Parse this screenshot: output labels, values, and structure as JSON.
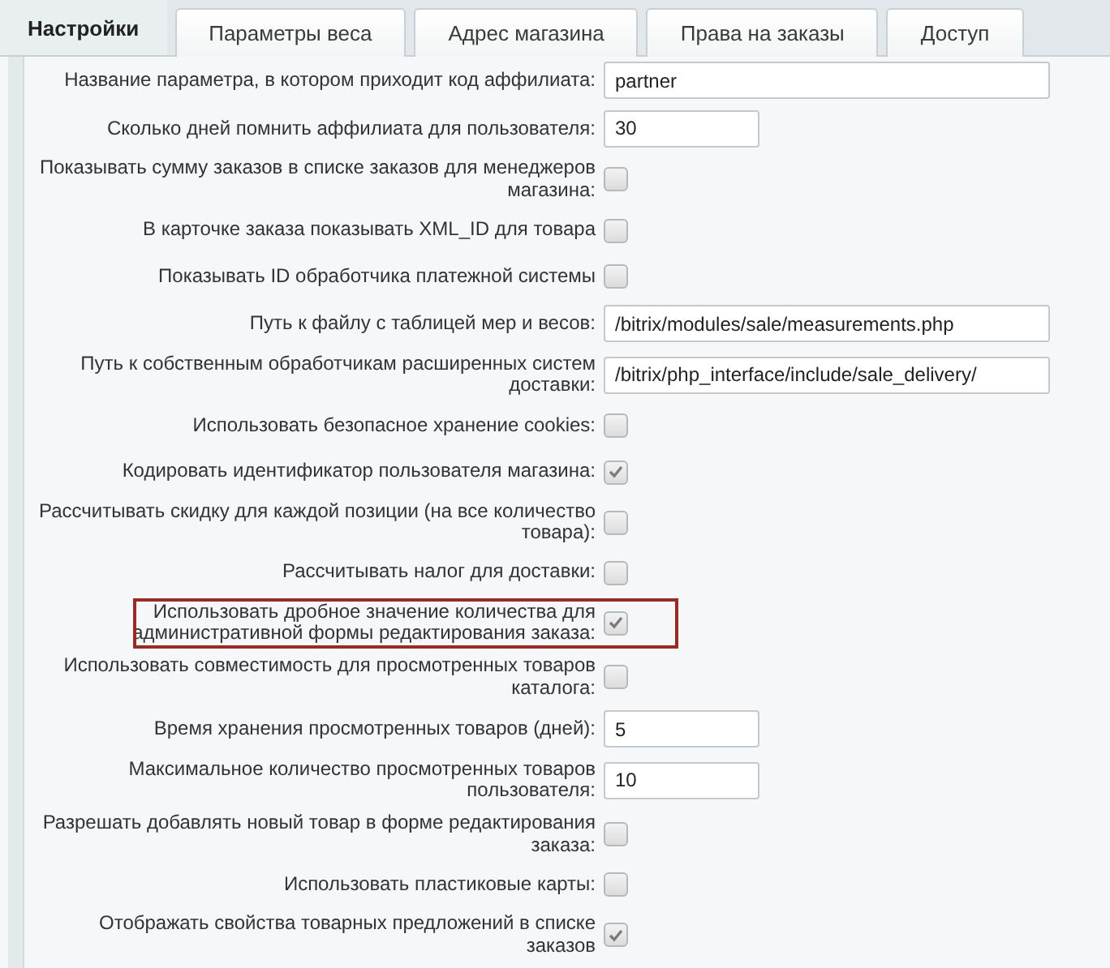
{
  "tabs": [
    {
      "label": "Настройки",
      "selected": true
    },
    {
      "label": "Параметры веса",
      "selected": false
    },
    {
      "label": "Адрес магазина",
      "selected": false
    },
    {
      "label": "Права на заказы",
      "selected": false
    },
    {
      "label": "Доступ",
      "selected": false
    }
  ],
  "settings": [
    {
      "kind": "text",
      "label": "Название параметра, в котором приходит код аффилиата:",
      "value": "partner",
      "wide": true
    },
    {
      "kind": "text",
      "label": "Сколько дней помнить аффилиата для пользователя:",
      "value": "30",
      "wide": false
    },
    {
      "kind": "checkbox",
      "label": "Показывать сумму заказов в списке заказов для менеджеров магазина:",
      "checked": false,
      "highlighted": false
    },
    {
      "kind": "checkbox",
      "label": "В карточке заказа показывать XML_ID для товара",
      "checked": false,
      "highlighted": false
    },
    {
      "kind": "checkbox",
      "label": "Показывать ID обработчика платежной системы",
      "checked": false,
      "highlighted": false
    },
    {
      "kind": "text",
      "label": "Путь к файлу с таблицей мер и весов:",
      "value": "/bitrix/modules/sale/measurements.php",
      "wide": true
    },
    {
      "kind": "text",
      "label": "Путь к собственным обработчикам расширенных систем доставки:",
      "value": "/bitrix/php_interface/include/sale_delivery/",
      "wide": true
    },
    {
      "kind": "checkbox",
      "label": "Использовать безопасное хранение cookies:",
      "checked": false,
      "highlighted": false
    },
    {
      "kind": "checkbox",
      "label": "Кодировать идентификатор пользователя магазина:",
      "checked": true,
      "highlighted": false
    },
    {
      "kind": "checkbox",
      "label": "Рассчитывать скидку для каждой позиции (на все количество товара):",
      "checked": false,
      "highlighted": false
    },
    {
      "kind": "checkbox",
      "label": "Рассчитывать налог для доставки:",
      "checked": false,
      "highlighted": false
    },
    {
      "kind": "checkbox",
      "label": "Использовать дробное значение количества для административной формы редактирования заказа:",
      "checked": true,
      "highlighted": true
    },
    {
      "kind": "checkbox",
      "label": "Использовать совместимость для просмотренных товаров каталога:",
      "checked": false,
      "highlighted": false
    },
    {
      "kind": "text",
      "label": "Время хранения просмотренных товаров (дней):",
      "value": "5",
      "wide": false
    },
    {
      "kind": "text",
      "label": "Максимальное количество просмотренных товаров пользователя:",
      "value": "10",
      "wide": false
    },
    {
      "kind": "checkbox",
      "label": "Разрешать добавлять новый товар в форме редактирования заказа:",
      "checked": false,
      "highlighted": false
    },
    {
      "kind": "checkbox",
      "label": "Использовать пластиковые карты:",
      "checked": false,
      "highlighted": false
    },
    {
      "kind": "checkbox",
      "label": "Отображать свойства товарных предложений в списке заказов",
      "checked": true,
      "highlighted": false
    }
  ]
}
